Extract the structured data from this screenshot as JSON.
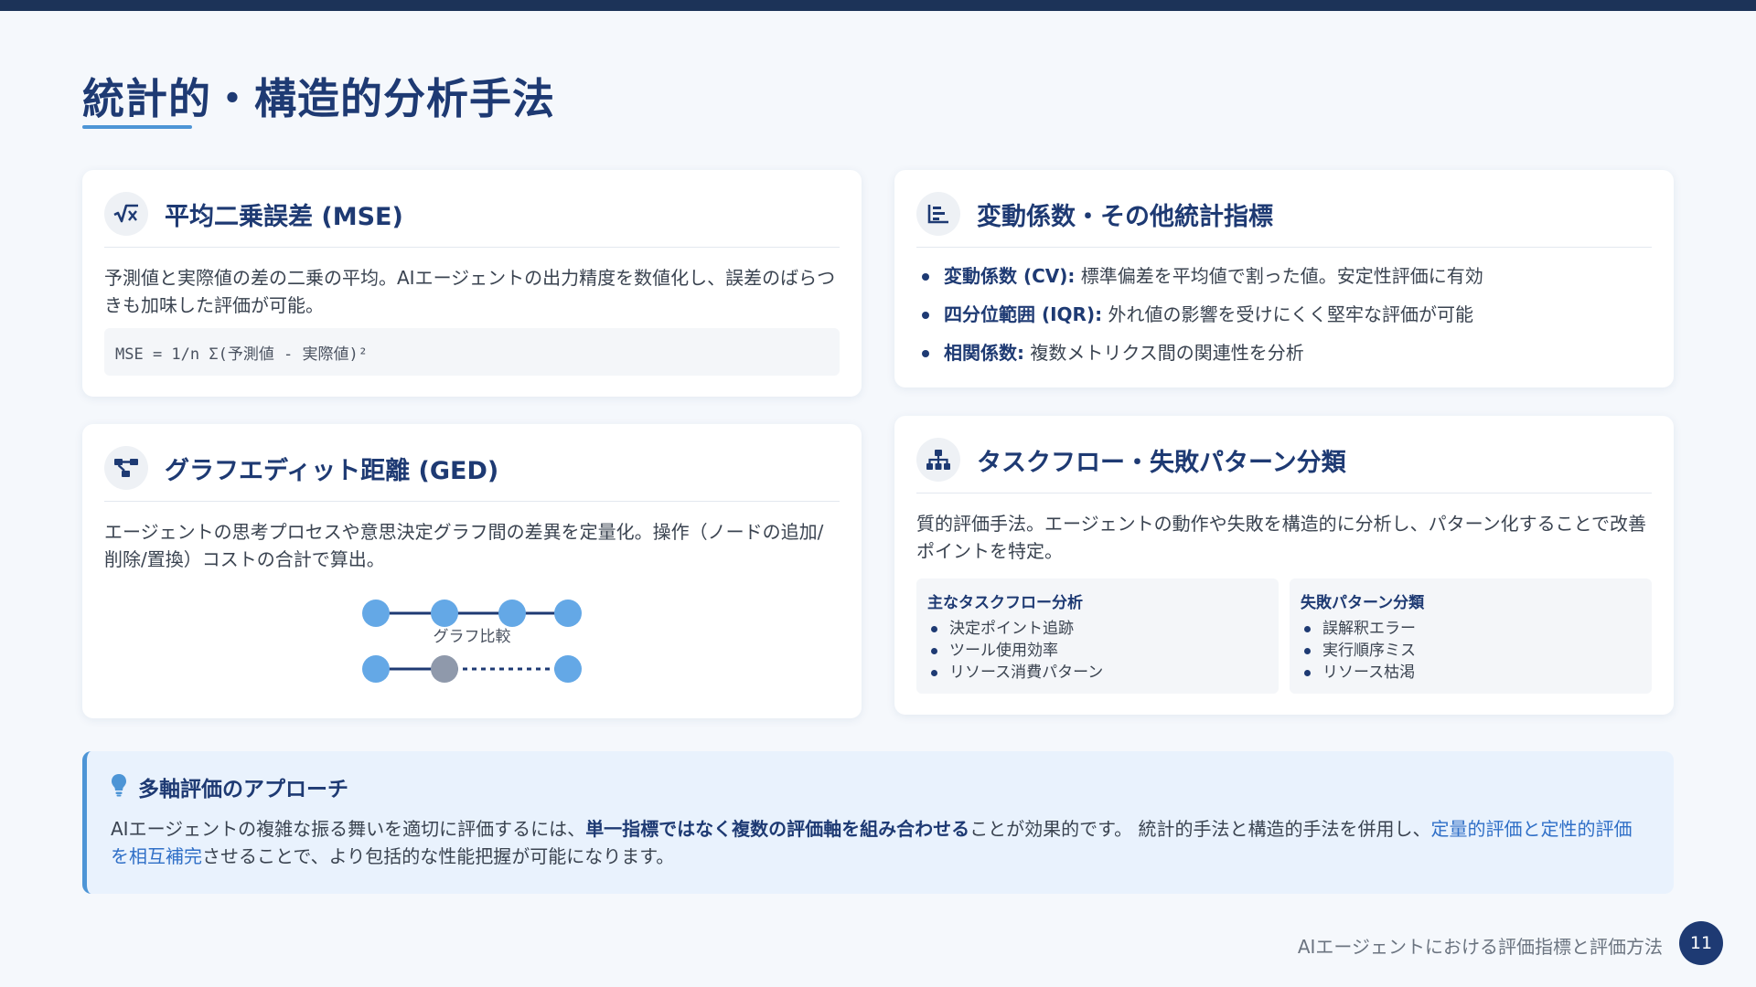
{
  "page": {
    "title": "統計的・構造的分析手法",
    "footer": "AIエージェントにおける評価指標と評価方法",
    "page_number": "11"
  },
  "colors": {
    "primary": "#1e3a73",
    "accent": "#4d95d6",
    "node": "#64a8e6",
    "node_gray": "#8f99ab",
    "highlight": "#2f6fc7"
  },
  "mse": {
    "icon": "square-root-icon",
    "title": "平均二乗誤差 (MSE)",
    "description": "予測値と実際値の差の二乗の平均。AIエージェントの出力精度を数値化し、誤差のばらつきも加味した評価が可能。",
    "formula": "MSE = 1/n Σ(予測値 - 実際値)²"
  },
  "ged": {
    "icon": "project-diagram-icon",
    "title": "グラフエディット距離 (GED)",
    "description": "エージェントの思考プロセスや意思決定グラフ間の差異を定量化。操作（ノードの追加/削除/置換）コストの合計で算出。",
    "graph_label": "グラフ比較"
  },
  "stats": {
    "icon": "chart-bar-icon",
    "title": "変動係数・その他統計指標",
    "items": [
      {
        "term": "変動係数 (CV):",
        "desc": "標準偏差を平均値で割った値。安定性評価に有効"
      },
      {
        "term": "四分位範囲 (IQR):",
        "desc": "外れ値の影響を受けにくく堅牢な評価が可能"
      },
      {
        "term": "相関係数:",
        "desc": "複数メトリクス間の関連性を分析"
      }
    ]
  },
  "taskflow": {
    "icon": "sitemap-icon",
    "title": "タスクフロー・失敗パターン分類",
    "description": "質的評価手法。エージェントの動作や失敗を構造的に分析し、パターン化することで改善ポイントを特定。",
    "boxes": [
      {
        "title": "主なタスクフロー分析",
        "items": [
          "決定ポイント追跡",
          "ツール使用効率",
          "リソース消費パターン"
        ]
      },
      {
        "title": "失敗パターン分類",
        "items": [
          "誤解釈エラー",
          "実行順序ミス",
          "リソース枯渇"
        ]
      }
    ]
  },
  "callout": {
    "icon": "lightbulb-icon",
    "title": "多軸評価のアプローチ",
    "text_1": "AIエージェントの複雑な振る舞いを適切に評価するには、",
    "text_bold": "単一指標ではなく複数の評価軸を組み合わせる",
    "text_2": "ことが効果的です。 統計的手法と構造的手法を併用し、",
    "text_highlight": "定量的評価と定性的評価を相互補完",
    "text_3": "させることで、より包括的な性能把握が可能になります。"
  }
}
